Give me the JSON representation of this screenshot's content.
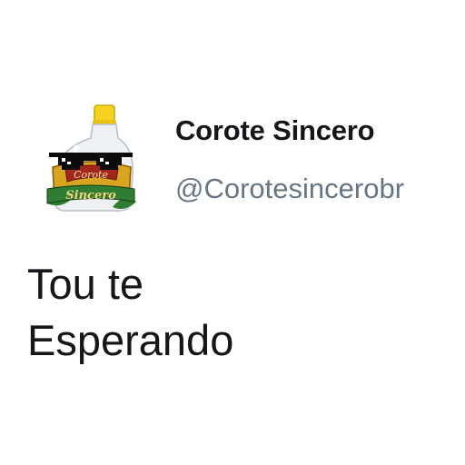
{
  "profile": {
    "display_name": "Corote Sincero",
    "handle": "@Corotesincerobr",
    "avatar": {
      "icon": "corote-bottle-sunglasses-logo-icon",
      "label_top": "Corote",
      "label_bottom": "Sincero"
    }
  },
  "tweet": {
    "lines": [
      "Tou te",
      "Esperando"
    ]
  },
  "colors": {
    "name": "#14171a",
    "handle": "#657786",
    "text": "#14171a",
    "background": "#ffffff",
    "bottle_cap": "#f4d21f",
    "label_gold": "#d9a520",
    "label_green": "#2e7d32"
  }
}
